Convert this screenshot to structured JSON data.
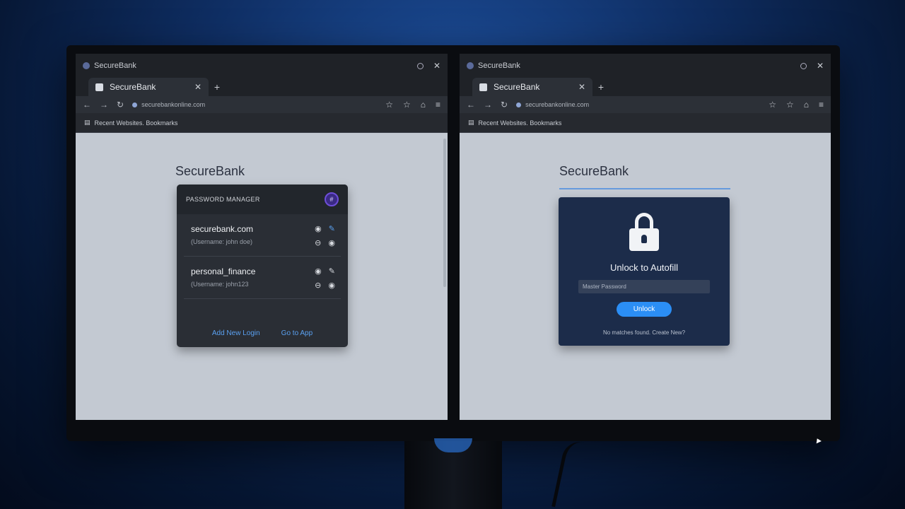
{
  "left_window": {
    "app_name": "SecureBank",
    "tab_label": "SecureBank",
    "url": "securebankonline.com",
    "bookmarks_text": "Recent Websites. Bookmarks",
    "brand": "SecureBank",
    "password_manager": {
      "title": "PASSWORD MANAGER",
      "avatar_glyph": "#",
      "entries": [
        {
          "site": "securebank.com",
          "username": "(Username: john doe)"
        },
        {
          "site": "personal_finance",
          "username": "(Username: john123"
        }
      ],
      "footer": {
        "add_label": "Add New Login",
        "goto_label": "Go to App"
      }
    }
  },
  "right_window": {
    "app_name": "SecureBank",
    "tab_label": "SecureBank",
    "url": "securebankonline.com",
    "bookmarks_text": "Recent Websites. Bookmarks",
    "brand": "SecureBank",
    "unlock": {
      "title": "Unlock to Autofill",
      "placeholder": "Master Password",
      "button_label": "Unlock",
      "hint": "No matches found. Create New?"
    }
  },
  "glyphs": {
    "close": "✕",
    "new_tab": "+",
    "back": "←",
    "forward": "→",
    "reload": "↻",
    "star": "☆",
    "extension": "⌂",
    "menu": "≡",
    "bookmarks_icon": "▤",
    "eye": "◉",
    "edit": "✎",
    "minus": "⊖"
  },
  "colors": {
    "accent_blue": "#2b8ef5",
    "link_blue": "#5aa0f0",
    "avatar_purple": "#6e4ed8",
    "unlock_card": "#1c2c4a"
  }
}
